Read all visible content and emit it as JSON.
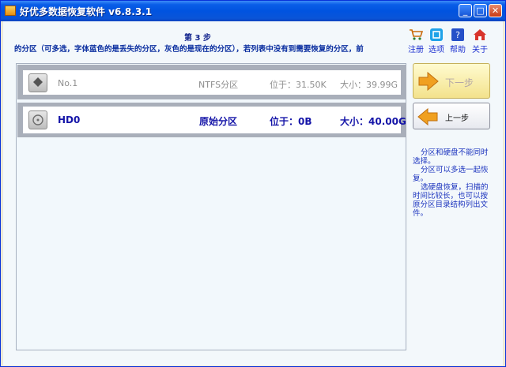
{
  "window": {
    "title": "好优多数据恢复软件  v6.8.3.1",
    "controls": {
      "minimize": "_",
      "maximize": "□",
      "close": "✕"
    }
  },
  "header": {
    "step": "第 3 步",
    "instruction": "的分区（可多选，字体蓝色的是丢失的分区，灰色的是现在的分区），若列表中没有到需要恢复的分区，前"
  },
  "toolbar": [
    {
      "label": "注册",
      "icon": "cart-icon"
    },
    {
      "label": "选项",
      "icon": "options-icon"
    },
    {
      "label": "帮助",
      "icon": "help-icon"
    },
    {
      "label": "关于",
      "icon": "home-icon"
    }
  ],
  "partitions": [
    {
      "name": "No.1",
      "type": "NTFS分区",
      "position": "位于：31.50K",
      "size": "大小：39.99G",
      "lost": false
    },
    {
      "name": "HD0",
      "type": "原始分区",
      "position": "位于：0B",
      "size": "大小：40.00G",
      "lost": true
    }
  ],
  "buttons": {
    "next": "下一步",
    "prev": "上一步"
  },
  "help": [
    "分区和硬盘不能同时选择。",
    "分区可以多选一起恢复。",
    "选硬盘恢复，扫描的时间比较长，也可以按原分区目录结构列出文件。"
  ],
  "colors": {
    "titlebar": "#0053E0",
    "lost_partition": "#1515A8",
    "current_partition": "#8E8E8E",
    "help_text": "#1A32BE"
  }
}
